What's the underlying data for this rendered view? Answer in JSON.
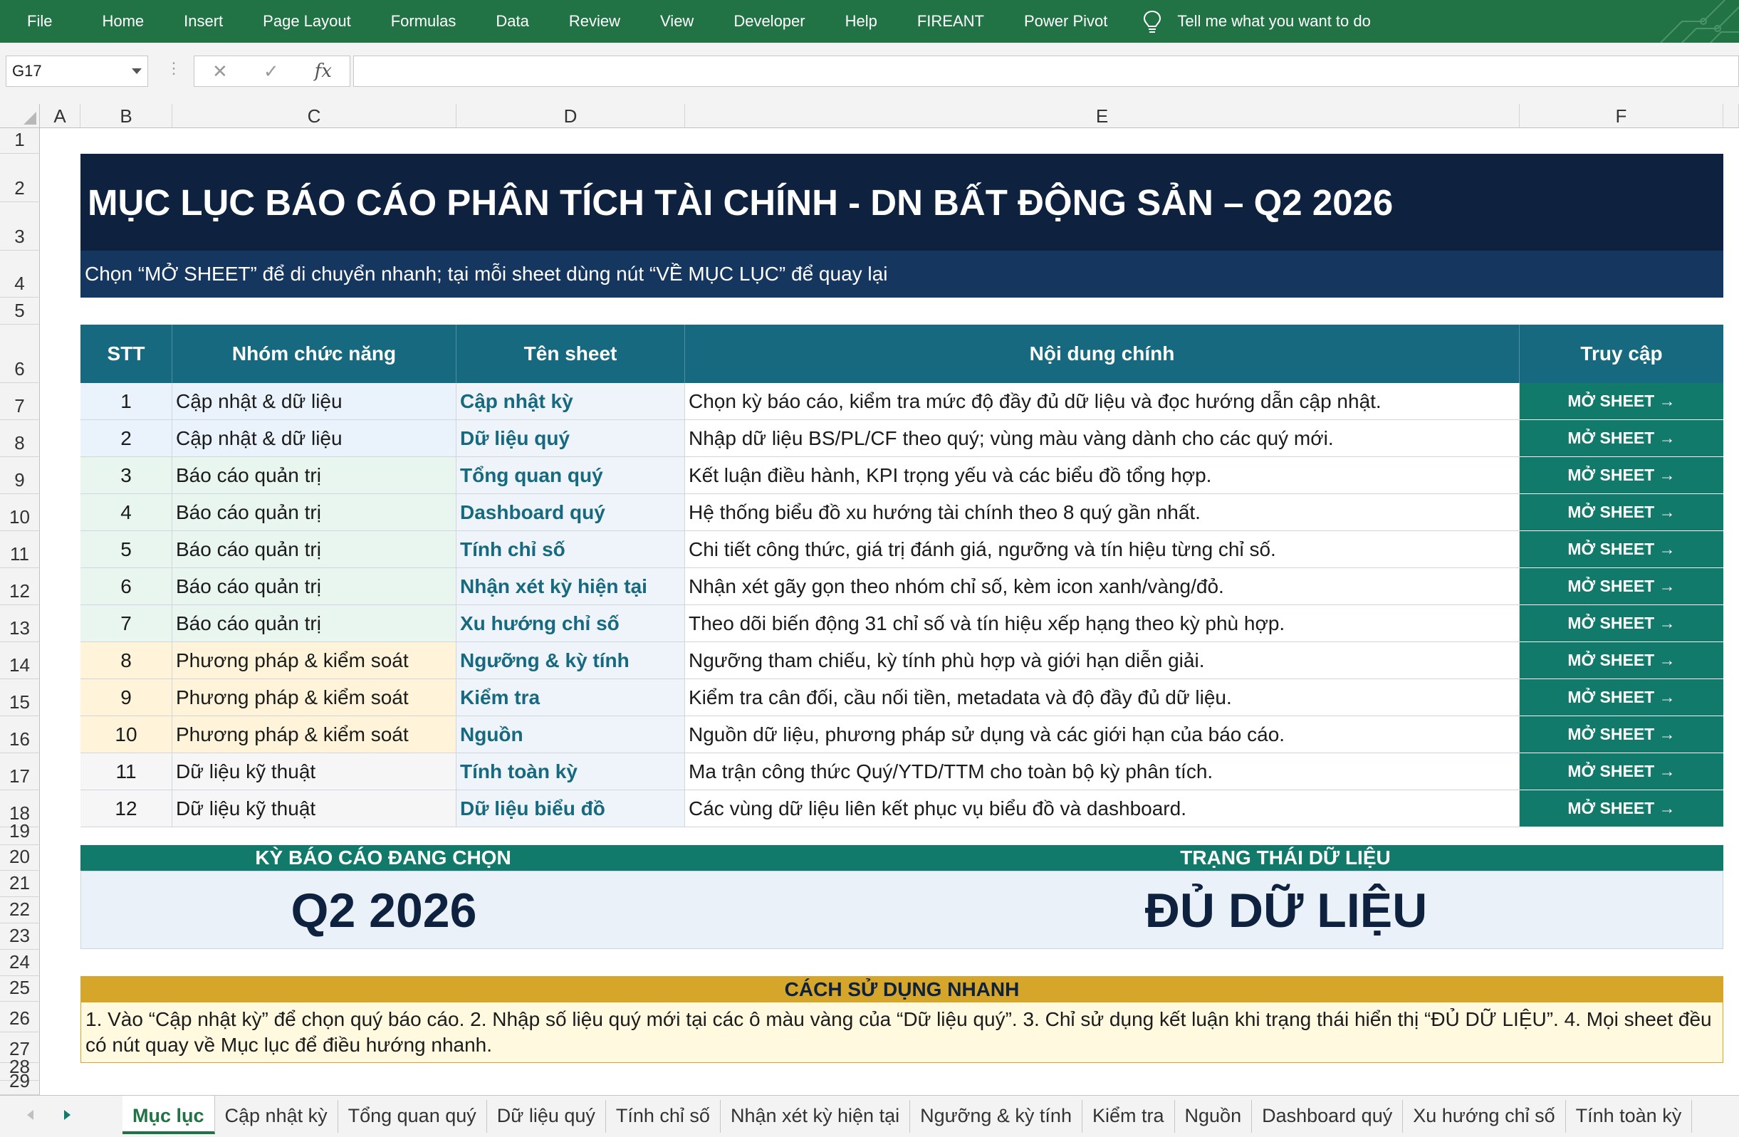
{
  "ribbon": {
    "tabs": [
      "File",
      "Home",
      "Insert",
      "Page Layout",
      "Formulas",
      "Data",
      "Review",
      "View",
      "Developer",
      "Help",
      "FIREANT",
      "Power Pivot"
    ],
    "tell_me": "Tell me what you want to do"
  },
  "formula_bar": {
    "name_box": "G17",
    "fx_label": "fx",
    "formula": ""
  },
  "columns": [
    "A",
    "B",
    "C",
    "D",
    "E",
    "F"
  ],
  "rows": [
    "1",
    "2",
    "3",
    "4",
    "5",
    "6",
    "7",
    "8",
    "9",
    "10",
    "11",
    "12",
    "13",
    "14",
    "15",
    "16",
    "17",
    "18",
    "19",
    "20",
    "21",
    "22",
    "23",
    "24",
    "25",
    "26",
    "27",
    "28",
    "29"
  ],
  "title": "MỤC LỤC BÁO CÁO PHÂN TÍCH TÀI CHÍNH - DN BẤT ĐỘNG SẢN – Q2 2026",
  "subtitle": "Chọn “MỞ SHEET” để di chuyển nhanh; tại mỗi sheet dùng nút “VỀ MỤC LỤC” để quay lại",
  "table": {
    "headers": [
      "STT",
      "Nhóm chức năng",
      "Tên sheet",
      "Nội dung chính",
      "Truy cập"
    ],
    "button_label": "MỞ SHEET →",
    "rows": [
      {
        "stt": "1",
        "group": "Cập nhật & dữ liệu",
        "sheet": "Cập nhật kỳ",
        "desc": "Chọn kỳ báo cáo, kiểm tra mức độ đầy đủ dữ liệu và đọc hướng dẫn cập nhật.",
        "tint": "#eaf2fb"
      },
      {
        "stt": "2",
        "group": "Cập nhật & dữ liệu",
        "sheet": "Dữ liệu quý",
        "desc": "Nhập dữ liệu BS/PL/CF theo quý; vùng màu vàng dành cho các quý mới.",
        "tint": "#eaf2fb"
      },
      {
        "stt": "3",
        "group": "Báo cáo quản trị",
        "sheet": "Tổng quan quý",
        "desc": "Kết luận điều hành, KPI trọng yếu và các biểu đồ tổng hợp.",
        "tint": "#e9f5ef"
      },
      {
        "stt": "4",
        "group": "Báo cáo quản trị",
        "sheet": "Dashboard quý",
        "desc": "Hệ thống biểu đồ xu hướng tài chính theo 8 quý gần nhất.",
        "tint": "#e9f5ef"
      },
      {
        "stt": "5",
        "group": "Báo cáo quản trị",
        "sheet": "Tính chỉ số",
        "desc": "Chi tiết công thức, giá trị đánh giá, ngưỡng và tín hiệu từng chỉ số.",
        "tint": "#e9f5ef"
      },
      {
        "stt": "6",
        "group": "Báo cáo quản trị",
        "sheet": "Nhận xét kỳ hiện tại",
        "desc": "Nhận xét gãy gọn theo nhóm chỉ số, kèm icon xanh/vàng/đỏ.",
        "tint": "#e9f5ef"
      },
      {
        "stt": "7",
        "group": "Báo cáo quản trị",
        "sheet": "Xu hướng chỉ số",
        "desc": "Theo dõi biến động 31 chỉ số và tín hiệu xếp hạng theo kỳ phù hợp.",
        "tint": "#e9f5ef"
      },
      {
        "stt": "8",
        "group": "Phương pháp & kiểm soát",
        "sheet": "Ngưỡng & kỳ tính",
        "desc": "Ngưỡng tham chiếu, kỳ tính phù hợp và giới hạn diễn giải.",
        "tint": "#fff4d9"
      },
      {
        "stt": "9",
        "group": "Phương pháp & kiểm soát",
        "sheet": "Kiểm tra",
        "desc": "Kiểm tra cân đối, cầu nối tiền, metadata và độ đầy đủ dữ liệu.",
        "tint": "#fff4d9"
      },
      {
        "stt": "10",
        "group": "Phương pháp & kiểm soát",
        "sheet": "Nguồn",
        "desc": "Nguồn dữ liệu, phương pháp sử dụng và các giới hạn của báo cáo.",
        "tint": "#fff4d9"
      },
      {
        "stt": "11",
        "group": "Dữ liệu kỹ thuật",
        "sheet": "Tính toàn kỳ",
        "desc": "Ma trận công thức Quý/YTD/TTM cho toàn bộ kỳ phân tích.",
        "tint": "#f6f6f6"
      },
      {
        "stt": "12",
        "group": "Dữ liệu kỹ thuật",
        "sheet": "Dữ liệu biểu đồ",
        "desc": "Các vùng dữ liệu liên kết phục vụ biểu đồ và dashboard.",
        "tint": "#f6f6f6"
      }
    ]
  },
  "status": {
    "period_label": "KỲ BÁO CÁO ĐANG CHỌN",
    "period_value": "Q2 2026",
    "data_label": "TRẠNG THÁI DỮ LIỆU",
    "data_value": "ĐỦ DỮ LIỆU"
  },
  "guide": {
    "title": "CÁCH SỬ DỤNG NHANH",
    "text": "1. Vào “Cập nhật kỳ” để chọn quý báo cáo.  2. Nhập số liệu quý mới tại các ô màu vàng của “Dữ liệu quý”.  3. Chỉ sử dụng kết luận khi trạng thái hiển thị “ĐỦ DỮ LIỆU”.  4. Mọi sheet đều có nút quay về Mục lục để điều hướng nhanh."
  },
  "sheet_tabs": [
    "Mục lục",
    "Cập nhật kỳ",
    "Tổng quan quý",
    "Dữ liệu quý",
    "Tính chỉ số",
    "Nhận xét kỳ hiện tại",
    "Ngưỡng & kỳ tính",
    "Kiểm tra",
    "Nguồn",
    "Dashboard quý",
    "Xu hướng chỉ số",
    "Tính toàn kỳ"
  ],
  "active_sheet_index": 0,
  "colors": {
    "ribbon": "#217346",
    "title_bg": "#0e2240",
    "header_bg": "#17697f",
    "button_bg": "#127a6a",
    "guide_bg": "#d5a629"
  }
}
